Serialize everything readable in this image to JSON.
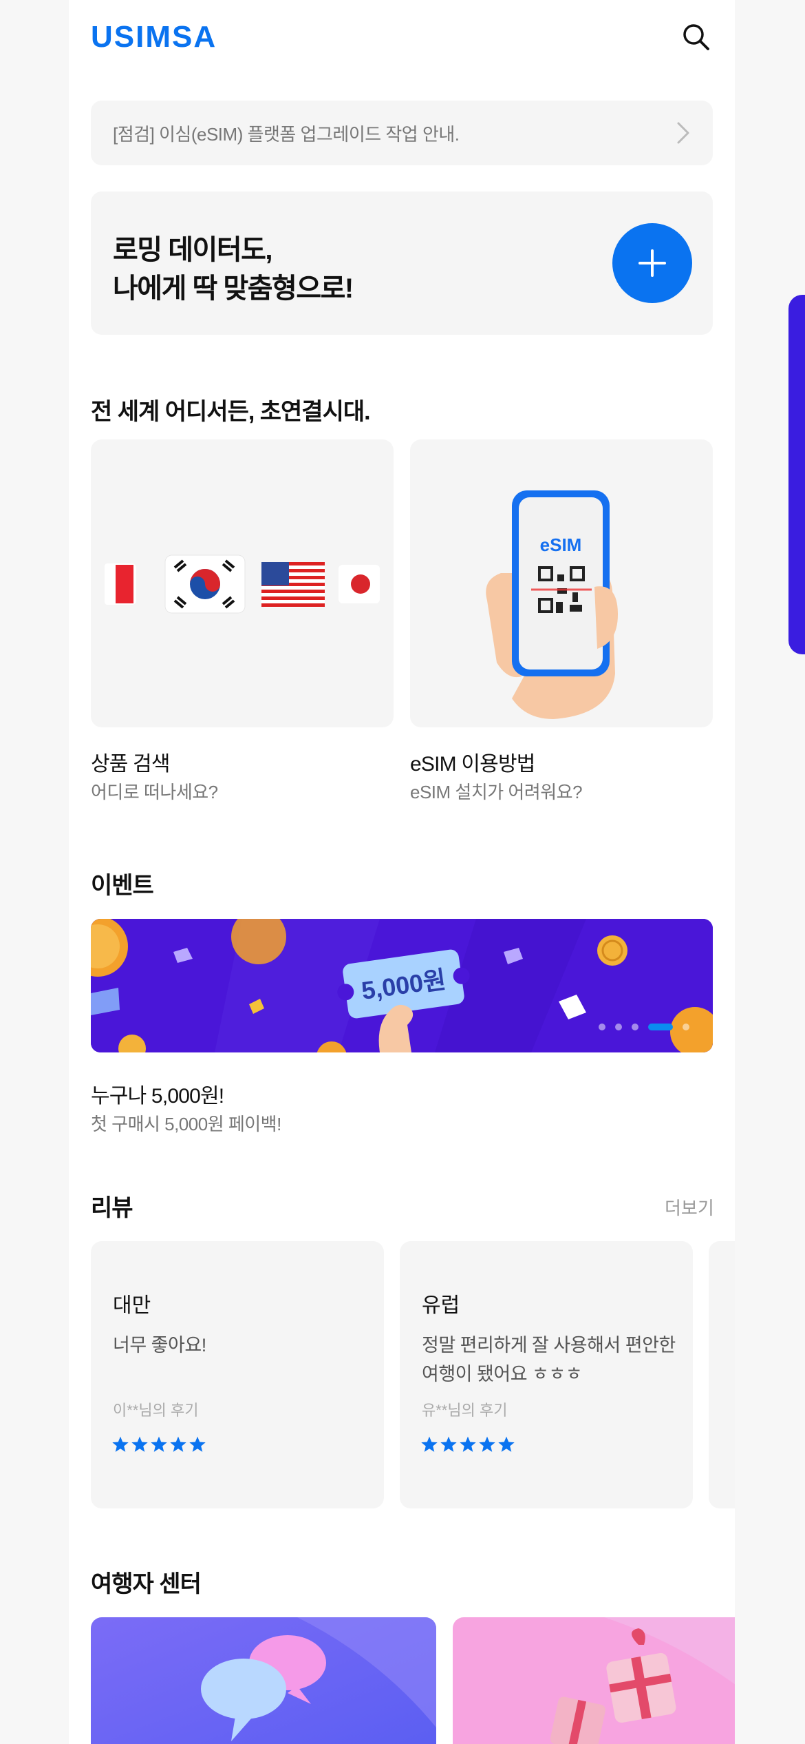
{
  "header": {
    "logo_text": "USIMSA",
    "search_icon": "search-icon"
  },
  "notice": {
    "text": "[점검] 이심(eSIM) 플랫폼 업그레이드 작업 안내.",
    "icon": "chevron-right-icon"
  },
  "hero": {
    "line1": "로밍 데이터도,",
    "line2": "나에게 딱 맞춤형으로!",
    "button_icon": "plus-icon"
  },
  "connect_section": {
    "title": "전 세계 어디서든, 초연결시대.",
    "cards": [
      {
        "title": "상품 검색",
        "subtitle": "어디로 떠나세요?",
        "image": "country-flags-illustration"
      },
      {
        "title": "eSIM 이용방법",
        "subtitle": "eSIM 설치가 어려워요?",
        "image_label": "eSIM"
      }
    ]
  },
  "event_section": {
    "title": "이벤트",
    "banner": {
      "ticket_text": "5,000원",
      "slide_count": 5,
      "active_slide": 4
    },
    "event_title": "누구나 5,000원!",
    "event_subtitle": "첫 구매시 5,000원 페이백!"
  },
  "review_section": {
    "title": "리뷰",
    "more_label": "더보기",
    "reviews": [
      {
        "region": "대만",
        "text": "너무 좋아요!",
        "author": "이**님의 후기",
        "rating": 5
      },
      {
        "region": "유럽",
        "text": "정말 편리하게 잘 사용해서 편안한 여행이 됐어요 ㅎㅎㅎ",
        "author": "유**님의 후기",
        "rating": 5
      }
    ]
  },
  "traveler_section": {
    "title": "여행자 센터"
  },
  "colors": {
    "accent": "#0a73f0",
    "banner": "#4a16d8",
    "side_tab": "#3a1de0",
    "card_bg": "#f5f5f5"
  }
}
